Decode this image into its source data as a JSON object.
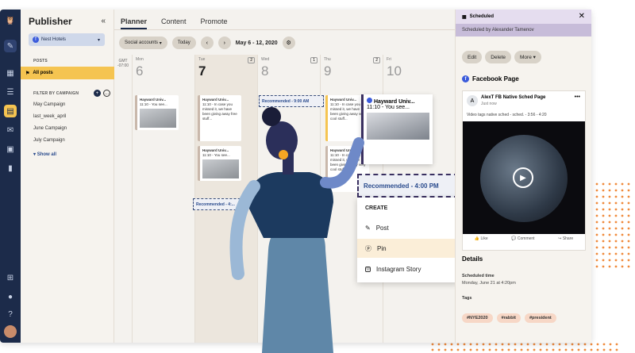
{
  "sidebar": {
    "app_title": "Publisher",
    "collapse_icon": "«",
    "account": "Nest Hotels",
    "posts_section": "POSTS",
    "all_posts": "All posts",
    "filter_section": "FILTER BY CAMPAIGN",
    "campaigns": [
      "May Campaign",
      "last_week_april",
      "June Campaign",
      "July Campaign"
    ],
    "show_all": "Show all"
  },
  "tabs": [
    {
      "label": "Planner",
      "active": true
    },
    {
      "label": "Content",
      "active": false
    },
    {
      "label": "Promote",
      "active": false
    }
  ],
  "toolbar": {
    "social_accounts": "Social accounts",
    "today": "Today",
    "date_range": "May 6 - 12, 2020"
  },
  "calendar": {
    "tz": "GMT -07:00",
    "days": [
      {
        "name": "Mon",
        "num": "6",
        "badge": ""
      },
      {
        "name": "Tue",
        "num": "7",
        "badge": "2"
      },
      {
        "name": "Wed",
        "num": "8",
        "badge": "1"
      },
      {
        "name": "Thu",
        "num": "9",
        "badge": "2"
      },
      {
        "name": "Fri",
        "num": "10",
        "badge": ""
      }
    ],
    "post_title": "Hayward Univ...",
    "post_mini_title": "Hayward Univ...",
    "post_mini_text1": "11:10 - In case you missed it, we have been giving away free stuff...",
    "post_mini_text2": "11:10 - In case you missed it, we have been giving away very cool stuff...",
    "post_mini_text3": "11:10 - You see...",
    "recommended_small_wed": "Recommended - 9:00 AM",
    "recommended_small_tue": "Recommended - 4:...",
    "popup_post_title": "Hayward Univ...",
    "popup_post_text": "11:10 - You see..."
  },
  "create_menu": {
    "recommended": "Recommended - 4:00 PM",
    "header": "CREATE",
    "items": [
      "Post",
      "Pin",
      "Instagram Story"
    ]
  },
  "preview": {
    "header": "Scheduled",
    "sub": "Scheduled by Alexander Tamenov",
    "buttons": [
      "Edit",
      "Delete",
      "More"
    ],
    "page_label": "Facebook Page",
    "card_name": "AlexT FB Native Sched Page",
    "card_time": "Just now",
    "card_caption": "Video tags native sched - sched. - 3:56 - 4:20",
    "card_actions": [
      "Like",
      "Comment",
      "Share"
    ],
    "details_title": "Details",
    "scheduled_time_label": "Scheduled time",
    "scheduled_time": "Monday, June 21 at 4:20pm",
    "tags_label": "Tags",
    "tags": [
      "#NYE2020",
      "#rabbit",
      "#president"
    ]
  },
  "colors": {
    "rail": "#1c2b4a",
    "accent": "#f5c451",
    "purple": "#3a3060",
    "tag": "#f7d7c6"
  }
}
